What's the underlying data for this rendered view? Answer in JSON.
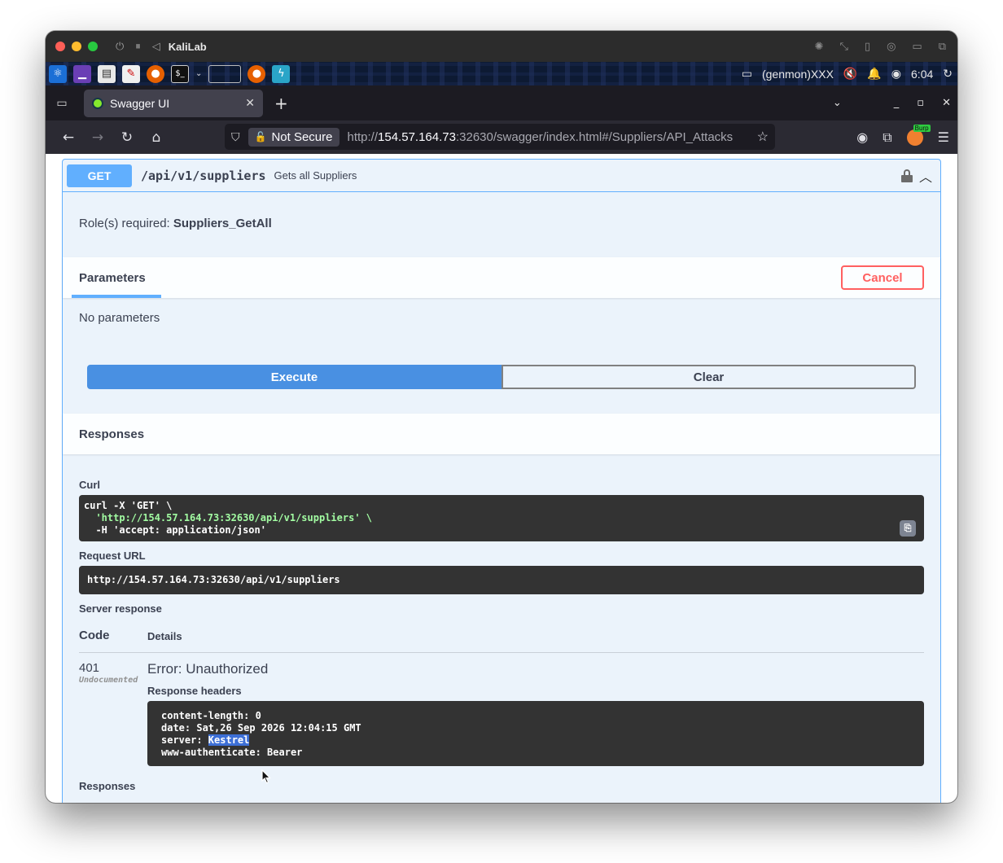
{
  "vm": {
    "title": "KaliLab",
    "controls": [
      "⏻",
      "⏸",
      "◁"
    ],
    "right_icons": [
      "brightness-icon",
      "resize-icon",
      "usb-icon",
      "audio-icon",
      "folder-icon",
      "window-icon"
    ]
  },
  "panel": {
    "genmon": "(genmon)XXX",
    "clock": "6:04"
  },
  "browser": {
    "tab_title": "Swagger UI",
    "security_label": "Not Secure",
    "url_prefix": "http://",
    "url_host": "154.57.164.73",
    "url_rest": ":32630/swagger/index.html#/Suppliers/API_Attacks",
    "burp_badge": "Burp"
  },
  "operation": {
    "method": "GET",
    "path": "/api/v1/suppliers",
    "description": "Gets all Suppliers",
    "roles_label": "Role(s) required:",
    "roles_value": "Suppliers_GetAll",
    "parameters_title": "Parameters",
    "cancel_label": "Cancel",
    "no_parameters": "No parameters",
    "execute_label": "Execute",
    "clear_label": "Clear",
    "responses_title": "Responses"
  },
  "result": {
    "curl_label": "Curl",
    "curl_lines": [
      "curl -X 'GET' \\",
      "  'http://154.57.164.73:32630/api/v1/suppliers' \\",
      "  -H 'accept: application/json'"
    ],
    "request_url_label": "Request URL",
    "request_url": "http://154.57.164.73:32630/api/v1/suppliers",
    "server_response_label": "Server response",
    "code_header": "Code",
    "details_header": "Details",
    "status_code": "401",
    "undocumented": "Undocumented",
    "error_title": "Error: Unauthorized",
    "response_headers_label": "Response headers",
    "headers": {
      "content_length": "content-length: 0",
      "date": "date: Sat,26 Sep 2026 12:04:15 GMT",
      "server_key": "server: ",
      "server_value": "Kestrel",
      "www_authenticate": "www-authenticate: Bearer"
    },
    "responses_bottom": "Responses"
  }
}
